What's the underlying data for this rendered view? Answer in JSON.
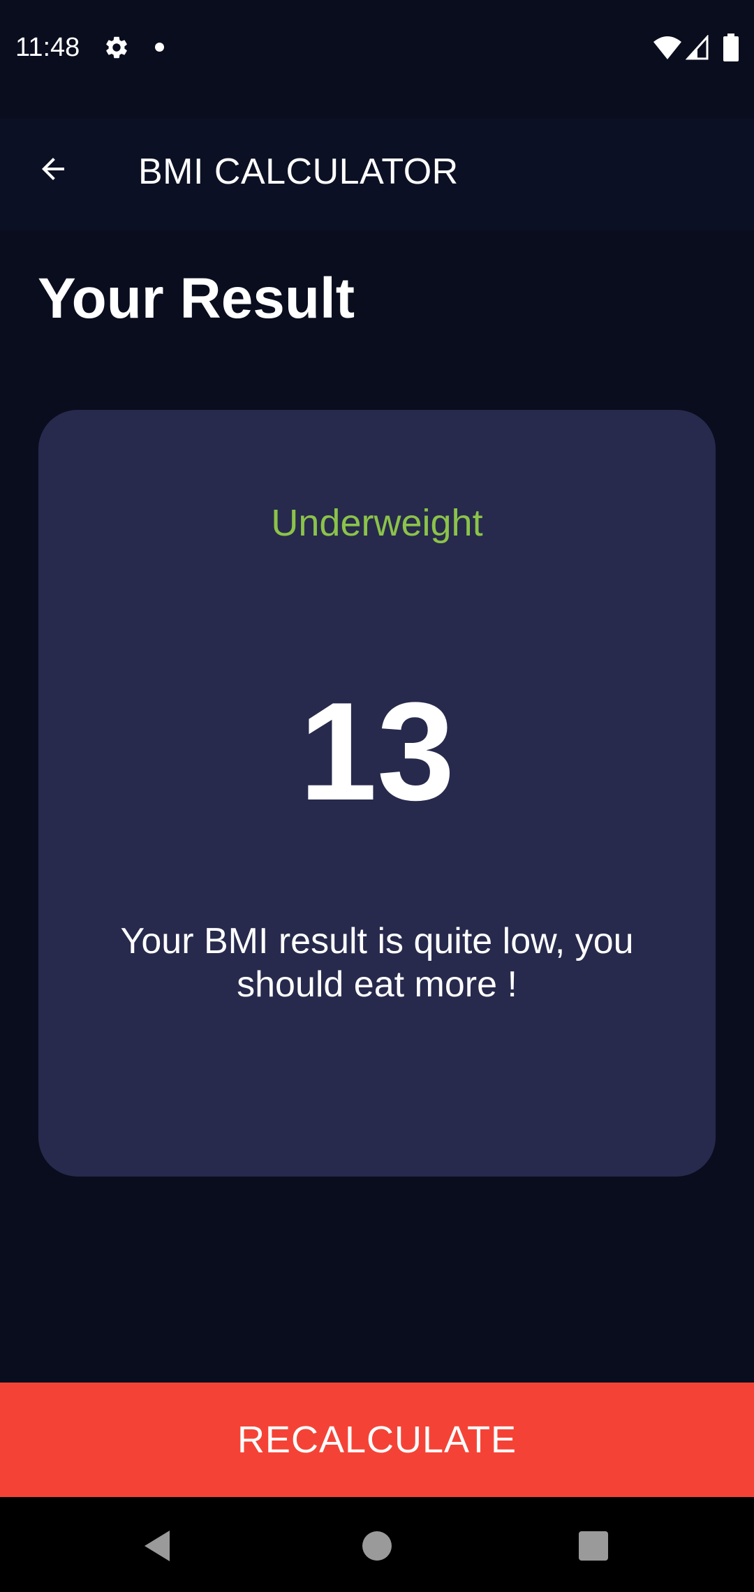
{
  "status_bar": {
    "time": "11:48",
    "icons": [
      "gear-icon",
      "notification-dot-icon",
      "wifi-icon",
      "cell-signal-icon",
      "battery-icon"
    ]
  },
  "app_bar": {
    "back_icon": "arrow-back-icon",
    "title": "BMI CALCULATOR"
  },
  "page": {
    "title": "Your Result"
  },
  "result": {
    "status": "Underweight",
    "value": "13",
    "message": "Your BMI result is quite low, you should eat more !"
  },
  "actions": {
    "recalculate_label": "RECALCULATE"
  },
  "nav_bar": {
    "icons": [
      "nav-back-icon",
      "nav-home-icon",
      "nav-recents-icon"
    ]
  },
  "colors": {
    "background": "#0a0d1e",
    "app_bar": "#0c1024",
    "card": "#272a4c",
    "status_text": "#8bc34a",
    "button": "#f44336"
  }
}
